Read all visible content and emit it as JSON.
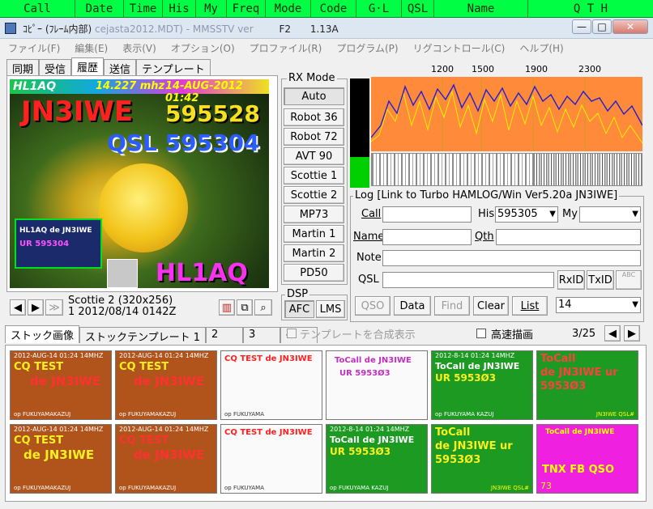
{
  "header_columns": [
    "Call",
    "Date",
    "Time",
    "His",
    "My",
    "Freq",
    "Mode",
    "Code",
    "G·L",
    "QSL",
    "Name",
    "Q T H"
  ],
  "title": {
    "left": "ｺﾋﾟｰ (ﾌﾚｰﾑ内部)",
    "ghost_mid": "cejasta2012.MDT) - MMSSTV ver",
    "f2": "F2",
    "version": "1.13A",
    "btn_min": "—",
    "btn_max": "□",
    "btn_close": "✕"
  },
  "menu": [
    "ファイル(F)",
    "編集(E)",
    "表示(V)",
    "オプション(O)",
    "プロファイル(R)",
    "プログラム(P)",
    "リグコントロール(C)",
    "ヘルプ(H)"
  ],
  "main_tabs": [
    "同期",
    "受信",
    "履歴",
    "送信",
    "テンプレート"
  ],
  "image": {
    "banner_call": "HL1AQ",
    "banner_freq": "14.227 mhz",
    "banner_date": "14-AUG-2012 01:42",
    "big_call": "JN3IWE",
    "rst": "595528",
    "qsl": "QSL 595304",
    "footer_call": "HL1AQ",
    "inset_line1": "HL1AQ de JN3IWE",
    "inset_line2": "UR 595304"
  },
  "image_caption": {
    "line1": "Scottie 2 (320x256)",
    "line2": "1 2012/08/14 0142Z"
  },
  "nav": {
    "prev": "◀",
    "next": "▶",
    "skip": "≫"
  },
  "rx_mode": {
    "title": "RX Mode",
    "modes": [
      "Auto",
      "Robot 36",
      "Robot 72",
      "AVT 90",
      "Scottie 1",
      "Scottie 2",
      "MP73",
      "Martin 1",
      "Martin 2",
      "PD50"
    ]
  },
  "dsp": {
    "title": "DSP",
    "afc": "AFC",
    "lms": "LMS"
  },
  "spectrum": {
    "ticks": [
      "1200",
      "1500",
      "1900",
      "2300"
    ]
  },
  "log": {
    "title": "Log [Link to Turbo HAMLOG/Win Ver5.20a JN3IWE]",
    "call_label": "Call",
    "call_value": "",
    "his_label": "His",
    "his_value": "595305",
    "my_label": "My",
    "my_value": "",
    "name_label": "Name",
    "name_value": "",
    "qth_label": "Qth",
    "qth_value": "",
    "note_label": "Note",
    "note_value": "",
    "qsl_label": "QSL",
    "qsl_value": "",
    "rxid": "RxID",
    "txid": "TxID",
    "abc": "ABC",
    "btn_qso": "QSO",
    "btn_data": "Data",
    "btn_find": "Find",
    "btn_clear": "Clear",
    "btn_list": "List",
    "band": "14"
  },
  "stock_tabs": [
    "ストック画像",
    "ストックテンプレート 1",
    "2",
    "3",
    "4"
  ],
  "stock_opts": {
    "template_merge": "テンプレートを合成表示",
    "fast_draw": "高速描画",
    "page": "3/25",
    "prev": "◀",
    "next": "▶"
  },
  "thumbnails": [
    {
      "top": "2012-AUG-14 01:24 14MHZ",
      "main": "CQ TEST",
      "sub": "de JN3IWE",
      "foot": "op FUKUYAMAKAZUJ"
    },
    {
      "top": "2012-AUG-14 01:24 14MHZ",
      "main": "CQ TEST",
      "sub": "de JN3IWE",
      "foot": "op FUKUYAMAKAZUJ"
    },
    {
      "top": "",
      "main": "CQ TEST de JN3IWE",
      "sub": "",
      "foot": "op FUKUYAMA"
    },
    {
      "top": "",
      "main": "ToCall de JN3IWE",
      "sub": "UR 5953Ø3",
      "foot": ""
    },
    {
      "top": "2012-8-14 01:24 14MHZ",
      "main": "ToCall de JN3IWE",
      "sub": "UR 5953Ø3",
      "foot": "op FUKUYAMA KAZUJ"
    },
    {
      "top": "",
      "main": "ToCall",
      "sub": "de JN3IWE ur 5953Ø3",
      "foot": "JN3IWE QSL#"
    },
    {
      "top": "2012-AUG-14 01:24 14MHZ",
      "main": "CQ TEST",
      "sub": "de JN3IWE",
      "foot": "op FUKUYAMAKAZUJ"
    },
    {
      "top": "2012-AUG-14 01:24 14MHZ",
      "main": "CQ TEST",
      "sub": "de JN3IWE",
      "foot": "op FUKUYAMAKAZUJ"
    },
    {
      "top": "",
      "main": "CQ TEST de JN3IWE",
      "sub": "",
      "foot": "op FUKUYAMA"
    },
    {
      "top": "2012-8-14 01:24 14MHZ",
      "main": "ToCall de JN3IWE",
      "sub": "UR 5953Ø3",
      "foot": "op FUKUYAMA KAZUJ"
    },
    {
      "top": "",
      "main": "ToCall",
      "sub": "de JN3IWE ur 5953Ø3",
      "foot": "JN3IWE QSL#"
    },
    {
      "top": "",
      "main": "ToCall de JN3IWE",
      "sub": "TNX FB QSO",
      "foot": "73"
    }
  ]
}
